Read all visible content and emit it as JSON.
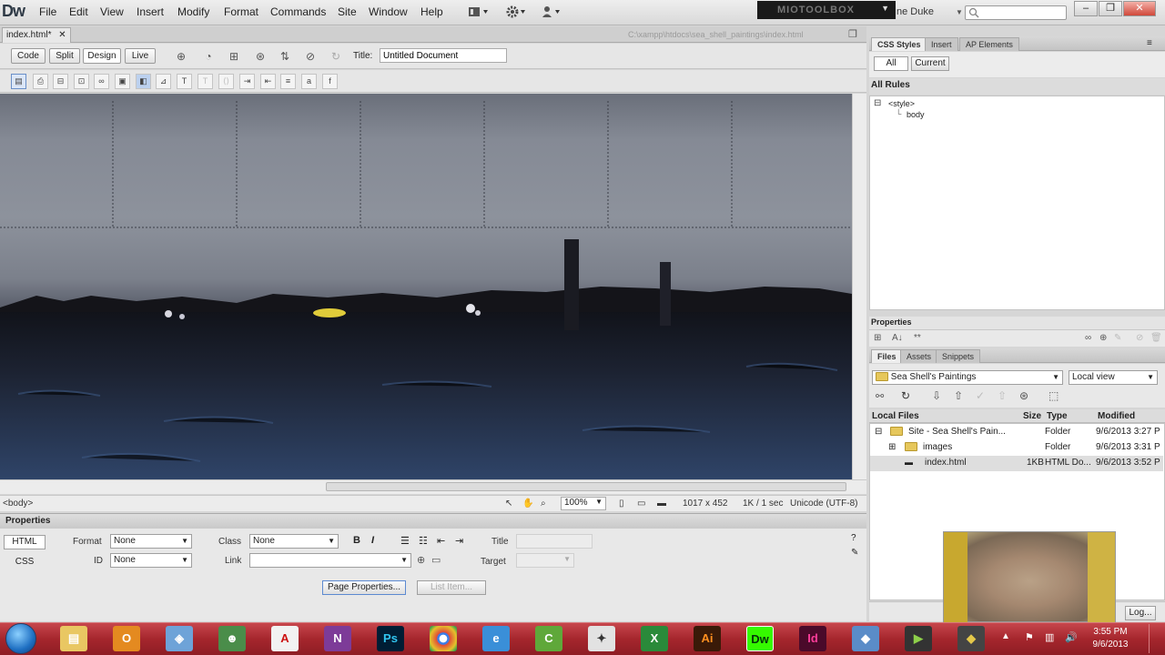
{
  "app": {
    "logo": "Dw",
    "workspace": "MIOTOOLBOX",
    "user": "ne Duke"
  },
  "menu": [
    "File",
    "Edit",
    "View",
    "Insert",
    "Modify",
    "Format",
    "Commands",
    "Site",
    "Window",
    "Help"
  ],
  "document": {
    "tab": "index.html*",
    "path": "C:\\xampp\\htdocs\\sea_shell_paintings\\index.html",
    "title_label": "Title:",
    "title_value": "Untitled Document"
  },
  "view_buttons": [
    "Code",
    "Split",
    "Design",
    "Live"
  ],
  "status": {
    "tag": "<body>",
    "zoom": "100%",
    "size": "1017 x 452",
    "download": "1K / 1 sec",
    "encoding": "Unicode (UTF-8)"
  },
  "properties": {
    "title": "Properties",
    "html_label": "HTML",
    "css_label": "CSS",
    "format_label": "Format",
    "format_value": "None",
    "id_label": "ID",
    "id_value": "None",
    "class_label": "Class",
    "class_value": "None",
    "link_label": "Link",
    "title_label": "Title",
    "target_label": "Target",
    "page_properties": "Page Properties...",
    "list_item": "List Item..."
  },
  "css_panel": {
    "tabs": [
      "CSS Styles",
      "Insert",
      "AP Elements"
    ],
    "modes": [
      "All",
      "Current"
    ],
    "section": "All Rules",
    "rules": [
      "<style>",
      "body"
    ],
    "footer": "Properties"
  },
  "files_panel": {
    "tabs": [
      "Files",
      "Assets",
      "Snippets"
    ],
    "site": "Sea Shell's Paintings",
    "view": "Local view",
    "columns": [
      "Local Files",
      "Size",
      "Type",
      "Modified"
    ],
    "rows": [
      {
        "name": "Site - Sea Shell's Pain...",
        "size": "",
        "type": "Folder",
        "modified": "9/6/2013 3:27 P"
      },
      {
        "name": "images",
        "size": "",
        "type": "Folder",
        "modified": "9/6/2013 3:31 P"
      },
      {
        "name": "index.html",
        "size": "1KB",
        "type": "HTML Do...",
        "modified": "9/6/2013 3:52 P"
      }
    ],
    "log": "Log..."
  },
  "taskbar": {
    "icons": [
      "explorer",
      "outlook",
      "network",
      "people",
      "acrobat",
      "onenote",
      "photoshop",
      "chrome",
      "ie",
      "camtasia",
      "tool",
      "excel",
      "illustrator",
      "dreamweaver",
      "indesign",
      "misc",
      "media",
      "app"
    ],
    "time": "3:55 PM",
    "date": "9/6/2013"
  },
  "colors": {
    "taskbar": "#a5262d",
    "dw_icon": "#35fa00",
    "ps_icon": "#001d34"
  }
}
